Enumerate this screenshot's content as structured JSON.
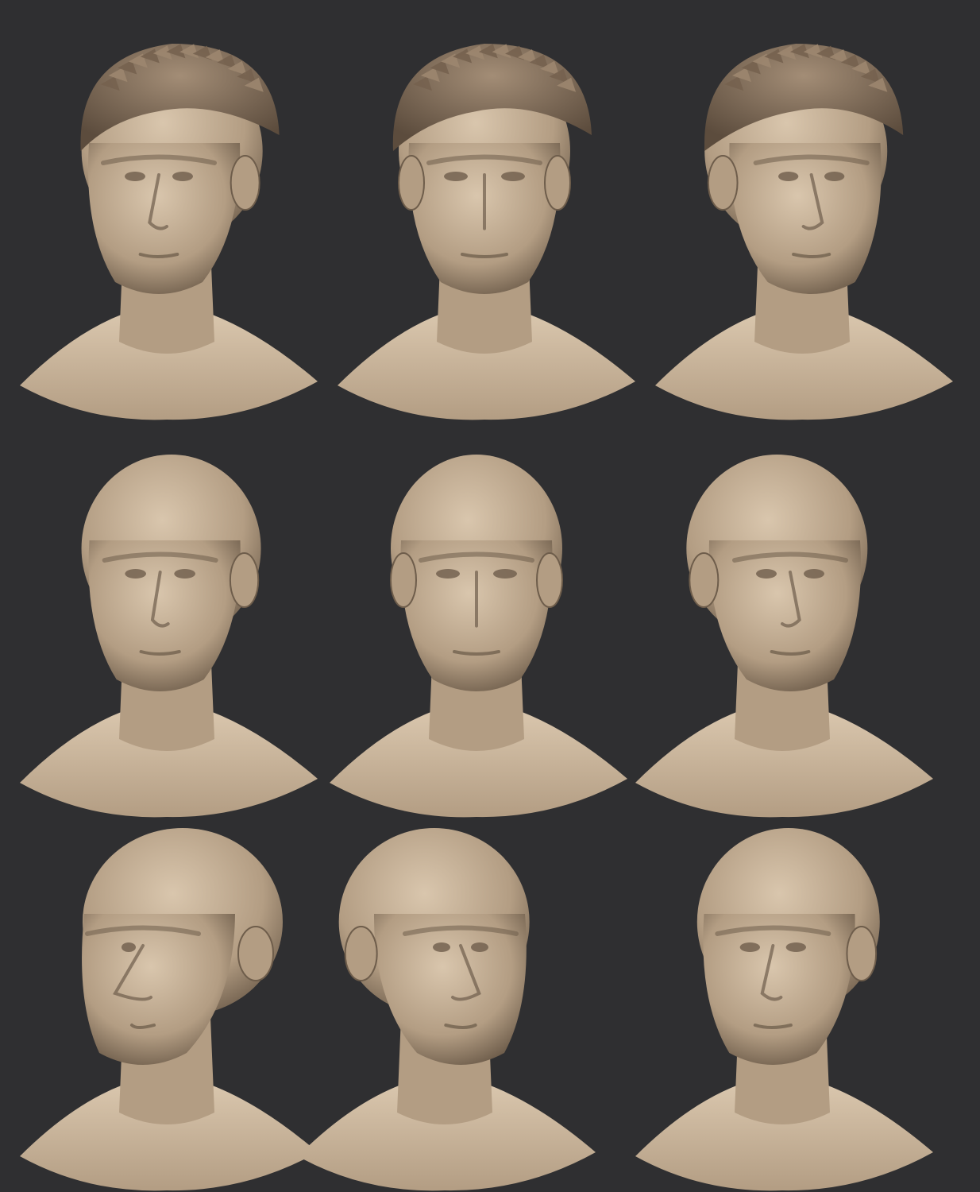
{
  "sheet": {
    "background": "#2f2f31",
    "clay_light": "#d9c6ad",
    "clay_mid": "#b39d83",
    "clay_dark": "#6e5d4b",
    "hair_color": "#8a7560"
  },
  "rows": [
    {
      "name": "hair-row",
      "has_hair": true,
      "views": [
        {
          "view": "three-quarter-left",
          "yaw": -30
        },
        {
          "view": "front",
          "yaw": 0
        },
        {
          "view": "three-quarter-right",
          "yaw": 35
        }
      ]
    },
    {
      "name": "bald-row",
      "has_hair": false,
      "views": [
        {
          "view": "three-quarter-left",
          "yaw": -25
        },
        {
          "view": "front",
          "yaw": 0
        },
        {
          "view": "three-quarter-right",
          "yaw": 30
        }
      ]
    },
    {
      "name": "profile-row",
      "has_hair": false,
      "views": [
        {
          "view": "profile-left",
          "yaw": -90
        },
        {
          "view": "profile-right",
          "yaw": 60
        },
        {
          "view": "three-quarter-left",
          "yaw": -35
        }
      ]
    }
  ]
}
